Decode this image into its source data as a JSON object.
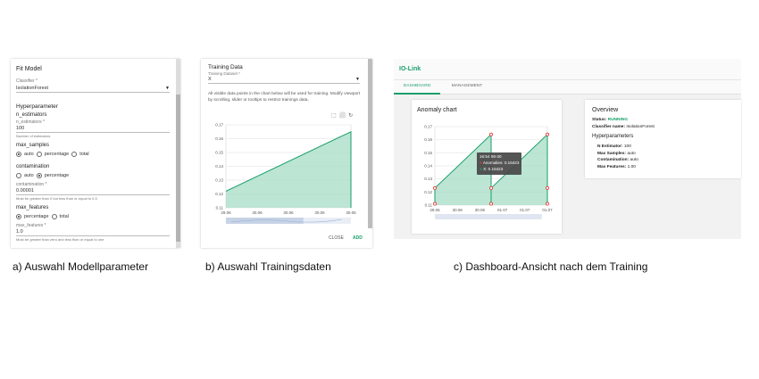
{
  "panel_a": {
    "title": "Fit Model",
    "classifier_label": "Classifier *",
    "classifier_value": "IsolationForest",
    "section_title": "Hyperparameter",
    "n_estimators": {
      "name": "n_estimators",
      "field_label": "n_estimators *",
      "value": "100",
      "helper": "Number of estimators"
    },
    "max_samples": {
      "name": "max_samples",
      "options": [
        "auto",
        "percentage",
        "total"
      ],
      "selected": "auto"
    },
    "contamination": {
      "name": "contamination",
      "options": [
        "auto",
        "percentage"
      ],
      "selected": "percentage",
      "field_label": "contamination *",
      "value": "0.00001",
      "helper": "Must be greater than 0 but less than or equal to 0.5"
    },
    "max_features": {
      "name": "max_features",
      "options": [
        "percentage",
        "total"
      ],
      "selected": "percentage",
      "field_label": "max_features *",
      "value": "1.0",
      "helper": "Must be greater than zero and less than or equal to one"
    }
  },
  "panel_b": {
    "title": "Training Data",
    "dataset_label": "Training Dataset *",
    "dataset_value": "X",
    "description": "All visible data points in the chart below will be used for training. Modify viewport by scrolling, slider or tooltips to restrict trainings data.",
    "close_label": "CLOSE",
    "add_label": "ADD",
    "accent": "#1a9e6b"
  },
  "panel_c": {
    "app_title": "IO-Link",
    "tabs": [
      "DASHBOARD",
      "MANAGEMENT"
    ],
    "active_tab": "DASHBOARD",
    "chart_title": "Anomaly chart",
    "tooltip": {
      "time": "16:54 06-30",
      "anomalies": "Anomalies: 0.16423",
      "x": "X: 0.16423"
    },
    "overview": {
      "title": "Overview",
      "status_label": "Status:",
      "status_value": "RUNNING",
      "classifier_label": "Classifier name:",
      "classifier_value": "IsolationForest",
      "hyper_title": "Hyperparameters",
      "rows": [
        {
          "label": "N Estimator:",
          "value": "100"
        },
        {
          "label": "Max Samples:",
          "value": "auto"
        },
        {
          "label": "Contamination:",
          "value": "auto"
        },
        {
          "label": "Max Features:",
          "value": "1.00"
        }
      ]
    },
    "accent": "#1a9e6b",
    "status_color": "#1a9e6b",
    "anomaly_color": "#e53935"
  },
  "captions": {
    "a": "a) Auswahl Modellparameter",
    "b": "b) Auswahl Trainingsdaten",
    "c": "c) Dashboard-Ansicht nach dem Training"
  },
  "chart_data": [
    {
      "type": "area",
      "ylim": [
        0.11,
        0.17
      ],
      "yticks": [
        "0.17",
        "0.16",
        "0.15",
        "0.14",
        "0.13",
        "0.12",
        "0.11"
      ],
      "xticks": [
        "29.06",
        "30.06",
        "30.06",
        "30.06",
        "30.06"
      ],
      "x": [
        0,
        1
      ],
      "values": [
        0.122,
        0.165
      ]
    },
    {
      "type": "area",
      "ylim": [
        0.11,
        0.17
      ],
      "yticks": [
        "0.17",
        "0.16",
        "0.15",
        "0.14",
        "0.13",
        "0.12",
        "0.11"
      ],
      "xticks": [
        "29.06",
        "30.06",
        "30.06",
        "01.07",
        "01.07",
        "01.07"
      ],
      "segments": [
        {
          "x": [
            0,
            0.5
          ],
          "values": [
            0.123,
            0.164
          ]
        },
        {
          "x": [
            0.5,
            1.0
          ],
          "values": [
            0.123,
            0.164
          ]
        }
      ],
      "anomaly_points": [
        {
          "x": 0,
          "value": 0.123
        },
        {
          "x": 0,
          "value": 0.111
        },
        {
          "x": 0.5,
          "value": 0.164
        },
        {
          "x": 0.5,
          "value": 0.123
        },
        {
          "x": 0.5,
          "value": 0.111
        },
        {
          "x": 1.0,
          "value": 0.164
        },
        {
          "x": 1.0,
          "value": 0.123
        },
        {
          "x": 1.0,
          "value": 0.111
        }
      ]
    }
  ]
}
